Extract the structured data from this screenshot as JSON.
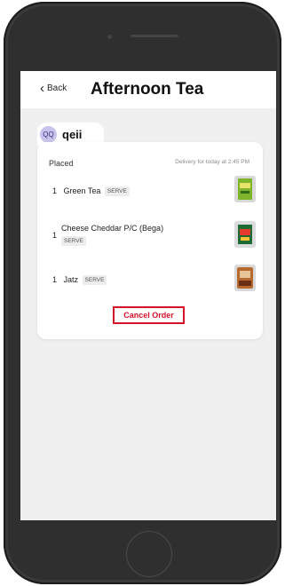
{
  "header": {
    "back_label": "Back",
    "title": "Afternoon Tea"
  },
  "user": {
    "initials": "QQ",
    "name": "qeii"
  },
  "order": {
    "status": "Placed",
    "delivery": "Delivery for today at 2:45 PM",
    "items": [
      {
        "qty": "1",
        "name": "Green Tea",
        "tag": "SERVE",
        "image": "green-tea-box"
      },
      {
        "qty": "1",
        "name": "Cheese Cheddar P/C (Bega)",
        "tag": "SERVE",
        "image": "cheese-pack"
      },
      {
        "qty": "1",
        "name": "Jatz",
        "tag": "SERVE",
        "image": "jatz-crackers"
      }
    ],
    "cancel_label": "Cancel Order"
  },
  "colors": {
    "accent_red": "#d4132a",
    "avatar_bg": "#c7c3ec"
  }
}
